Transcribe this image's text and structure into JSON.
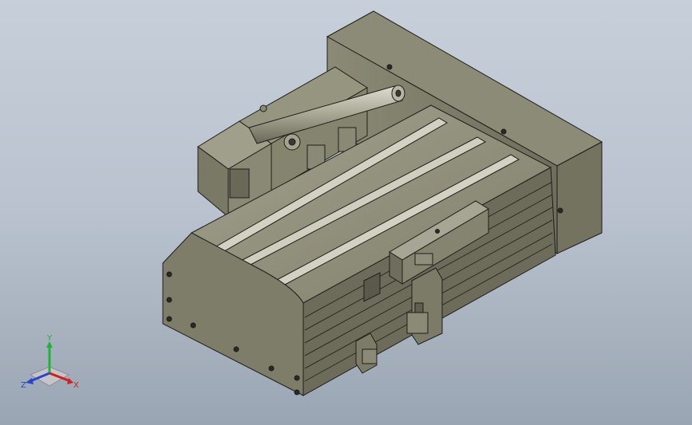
{
  "viewport": {
    "background_top": "#c7cfda",
    "background_bottom": "#9aa5b3"
  },
  "triad": {
    "x_label": "X",
    "y_label": "Y",
    "z_label": "Z",
    "x_color": "#d21e1e",
    "y_color": "#1fb33a",
    "z_color": "#2a45c9"
  },
  "model": {
    "body_color": "#86846f",
    "shade_color": "#5f5e4f",
    "highlight_color": "#c9c8b8",
    "edge_color": "#1e1e1a"
  }
}
